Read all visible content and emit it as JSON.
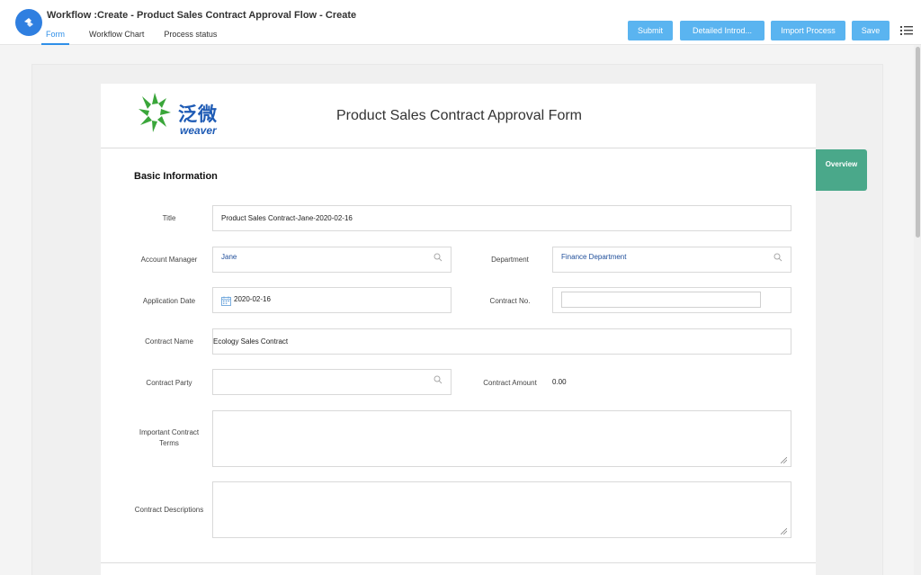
{
  "header": {
    "title": "Workflow :Create - Product Sales Contract Approval Flow - Create",
    "tabs": [
      {
        "label": "Form",
        "active": true
      },
      {
        "label": "Workflow Chart",
        "active": false
      },
      {
        "label": "Process status",
        "active": false
      }
    ],
    "buttons": {
      "submit": "Submit",
      "detailed": "Detailed Introd...",
      "import": "Import Process",
      "save": "Save"
    }
  },
  "form": {
    "brand_cn": "泛微",
    "brand_en": "weaver",
    "title": "Product Sales Contract Approval Form",
    "section": "Basic Information",
    "fields": {
      "title_label": "Title",
      "title_value": "Product Sales Contract-Jane-2020-02-16",
      "account_manager_label": "Account Manager",
      "account_manager_value": "Jane",
      "department_label": "Department",
      "department_value": "Finance Department",
      "application_date_label": "Application Date",
      "application_date_value": "2020-02-16",
      "contract_no_label": "Contract No.",
      "contract_no_value": "",
      "contract_name_label": "Contract Name",
      "contract_name_value": "Ecology Sales Contract",
      "contract_party_label": "Contract Party",
      "contract_party_value": "",
      "contract_amount_label": "Contract Amount",
      "contract_amount_value": "0.00",
      "important_terms_label_1": "Important Contract",
      "important_terms_label_2": "Terms",
      "important_terms_value": "",
      "descriptions_label": "Contract Descriptions",
      "descriptions_value": ""
    }
  },
  "overview": "Overview",
  "colors": {
    "accent": "#2f8fe8",
    "button": "#5ab4f0",
    "overview": "#4aa88a",
    "brand_green": "#3aa63a",
    "brand_blue": "#1e5bb5"
  }
}
